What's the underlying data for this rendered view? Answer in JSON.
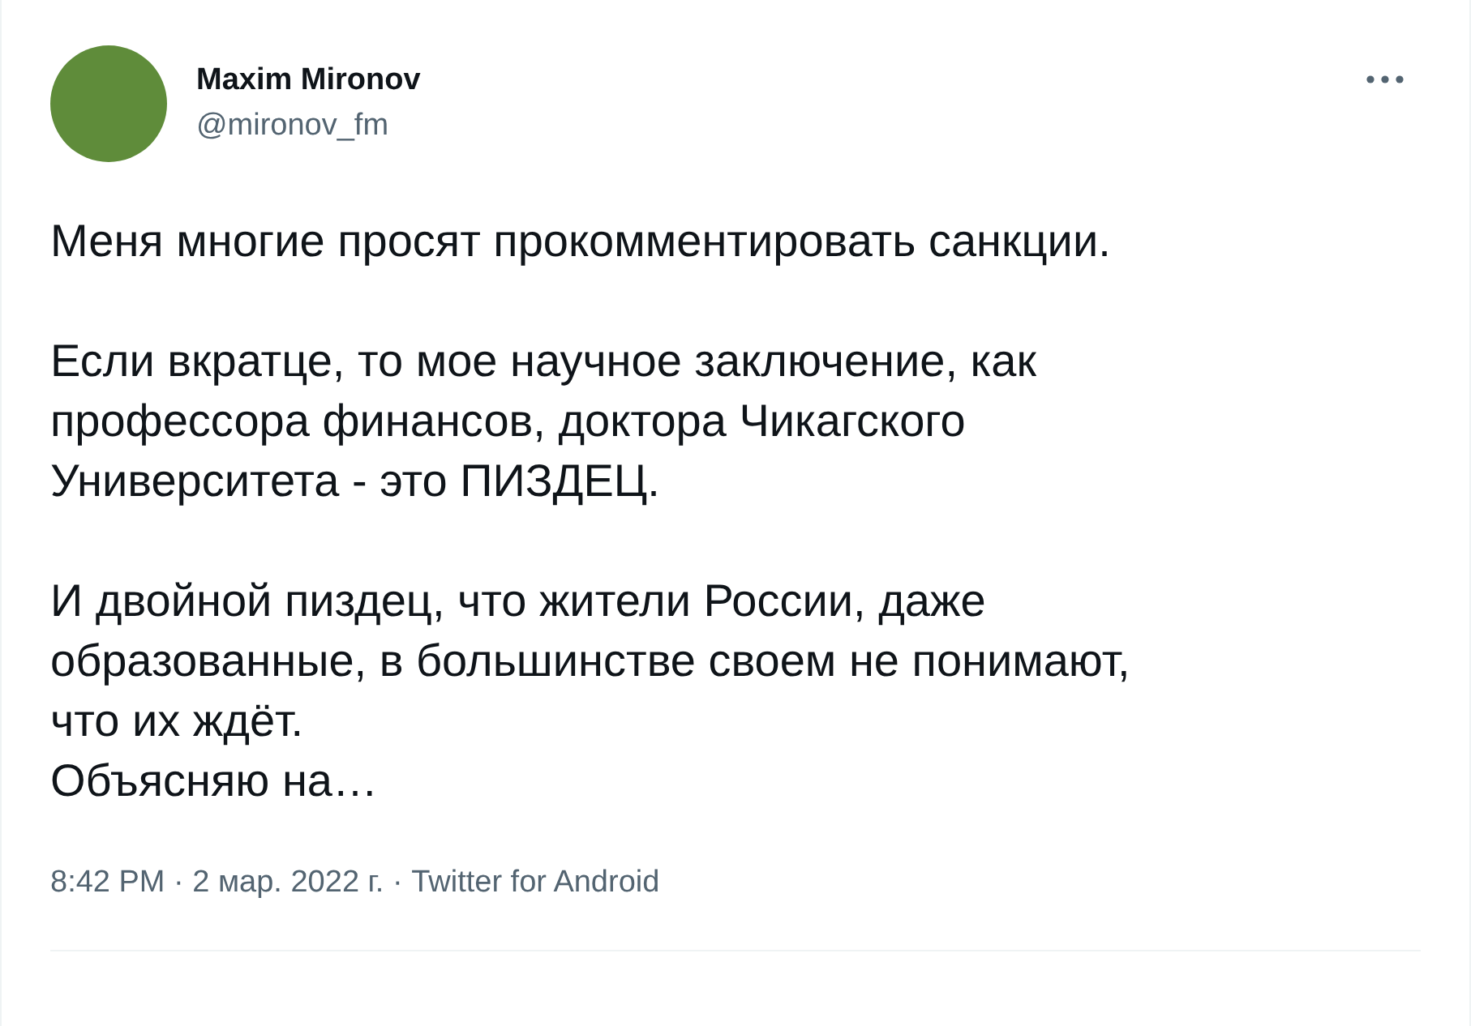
{
  "author": {
    "name": "Maxim Mironov",
    "handle": "@mironov_fm"
  },
  "paragraphs": [
    "Меня многие просят прокомментировать санкции.",
    "Если вкратце, то мое научное заключение, как\nпрофессора финансов, доктора Чикагского\nУниверситета - это ПИЗДЕЦ.",
    "И двойной пиздец, что жители России, даже\nобразованные, в большинстве своем не понимают,\nчто их ждёт.\nОбъясняю на…"
  ],
  "meta": "8:42 PM · 2 мар. 2022 г. · Twitter for Android"
}
